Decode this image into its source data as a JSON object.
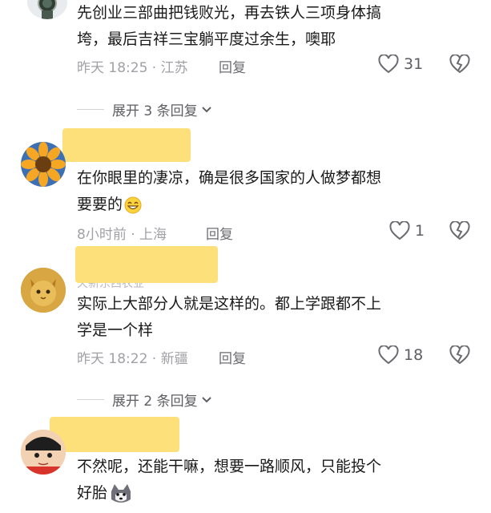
{
  "comments": [
    {
      "text_line1": "先创业三部曲把钱败光，再去铁人三项身体搞",
      "text_line2": "垮，最后吉祥三宝躺平度过余生，噢耶",
      "meta": "昨天 18:25 · 江苏",
      "reply_label": "回复",
      "likes": "31"
    },
    {
      "text_line1": "在你眼里的凄凉，确是很多国家的人做梦都想",
      "text_line2": "要要的",
      "meta": "8小时前 · 上海",
      "reply_label": "回复",
      "likes": "1"
    },
    {
      "username_partial": "天新东西农业",
      "text_line1": "实际上大部分人就是这样的。都上学跟都不上",
      "text_line2": "学是一个样",
      "meta": "昨天 18:22 · 新疆",
      "reply_label": "回复",
      "likes": "18"
    },
    {
      "text_line1": "不然呢，还能干嘛，想要一路顺风，只能投个",
      "text_line2": "好胎"
    }
  ],
  "expanders": [
    {
      "label": "展开 3 条回复"
    },
    {
      "label": "展开 2 条回复"
    }
  ],
  "icons": {
    "like": "heart-outline-icon",
    "dislike": "broken-heart-icon",
    "expand": "chevron-down-icon"
  },
  "colors": {
    "highlight": "#fde07a",
    "meta": "#a0a0a6",
    "text": "#1a1a1a"
  }
}
